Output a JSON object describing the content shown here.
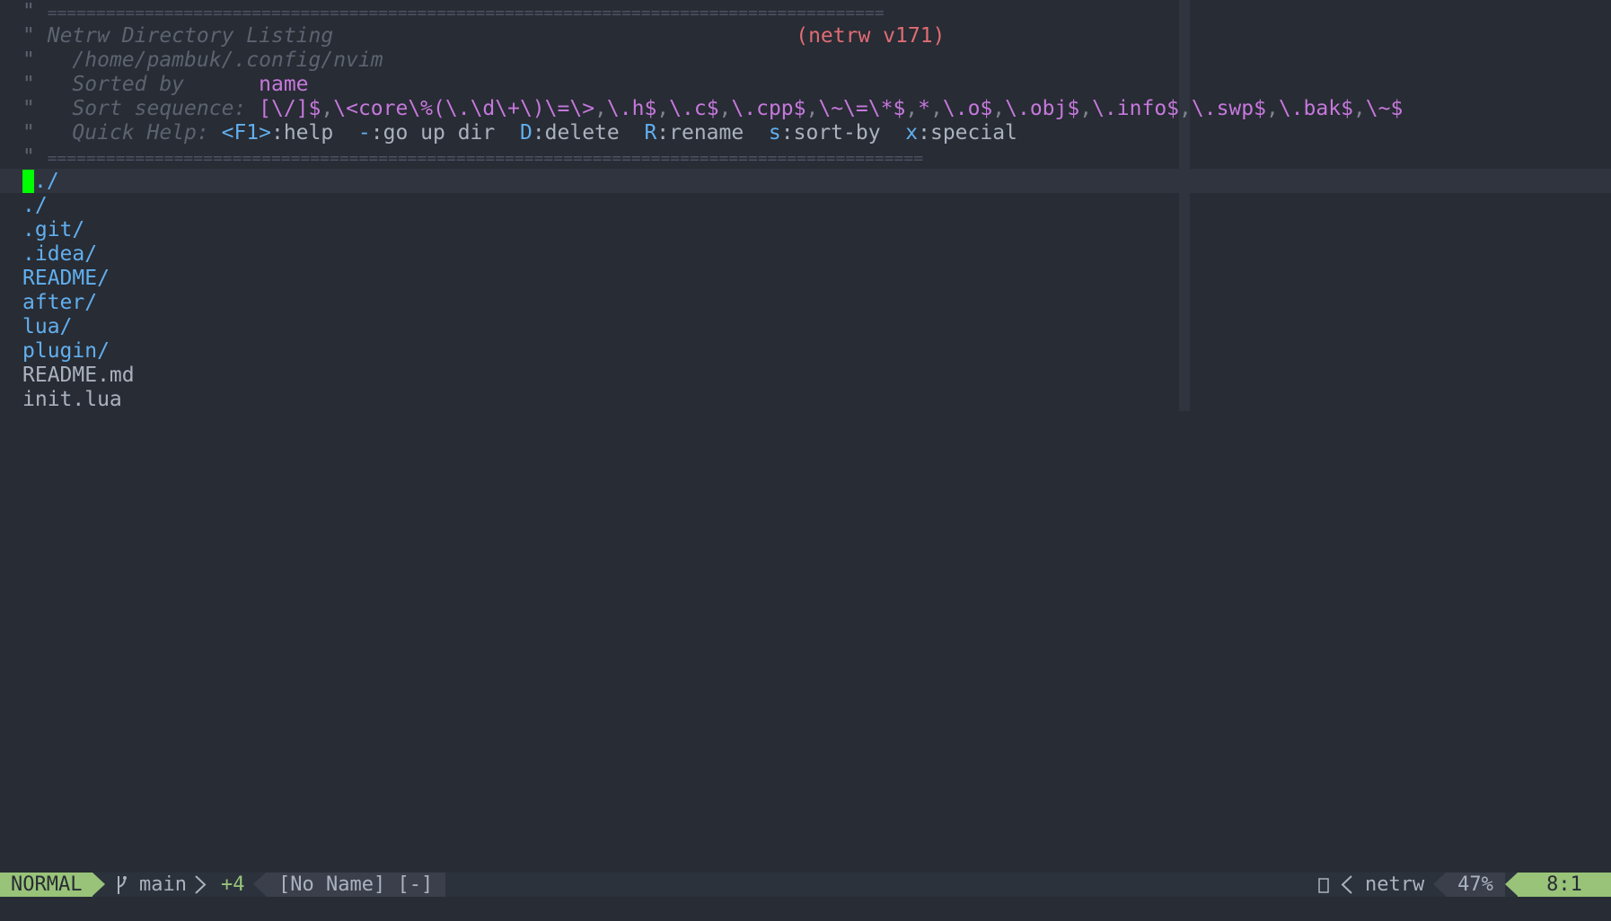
{
  "editor": "nvim",
  "banner": {
    "quote": "\"",
    "separator_top": "======================================================================================",
    "separator_bottom": "==========================================================================================",
    "title": "Netrw Directory Listing",
    "version": "(netrw v171)",
    "path": "/home/pambuk/.config/nvim",
    "sorted_by_label": "Sorted by",
    "sorted_by_value": "name",
    "sort_sequence_label": "Sort sequence:",
    "sort_sequence": [
      "[\\/]$",
      ",",
      "\\<core\\%(\\.\\d\\+\\)\\=\\>",
      ",",
      "\\.h$",
      ",",
      "\\.c$",
      ",",
      "\\.cpp$",
      ",",
      "\\~\\=\\*$",
      ",",
      "*",
      ",",
      "\\.o$",
      ",",
      "\\.obj$",
      ",",
      "\\.info$",
      ",",
      "\\.swp$",
      ",",
      "\\.bak$",
      ",",
      "\\~$"
    ],
    "quick_help_label": "Quick Help:",
    "quick_help": [
      {
        "key": "<F1>",
        "text": ":help  "
      },
      {
        "key": "-",
        "text": ":go up dir  "
      },
      {
        "key": "D",
        "text": ":delete  "
      },
      {
        "key": "R",
        "text": ":rename  "
      },
      {
        "key": "s",
        "text": ":sort-by  "
      },
      {
        "key": "x",
        "text": ":special"
      }
    ]
  },
  "entries": [
    {
      "name": "./",
      "type": "dir"
    },
    {
      "name": "./",
      "type": "dir"
    },
    {
      "name": ".git/",
      "type": "dir"
    },
    {
      "name": ".idea/",
      "type": "dir"
    },
    {
      "name": "README/",
      "type": "dir"
    },
    {
      "name": "after/",
      "type": "dir"
    },
    {
      "name": "lua/",
      "type": "dir"
    },
    {
      "name": "plugin/",
      "type": "dir"
    },
    {
      "name": "README.md",
      "type": "file"
    },
    {
      "name": "init.lua",
      "type": "file"
    }
  ],
  "statusline": {
    "mode": "NORMAL",
    "branch_icon": "branch-icon",
    "branch": "main",
    "diff": "+4",
    "buffer_name": "[No Name] [-]",
    "file_icon": "file-icon",
    "filetype": "netrw",
    "percent": "47%",
    "position": "8:1"
  },
  "colors": {
    "background": "#282c34",
    "mode_bg": "#98c379",
    "directory": "#61afef",
    "version": "#e06c75",
    "magenta": "#c678dd",
    "cursor": "#00ff00"
  }
}
